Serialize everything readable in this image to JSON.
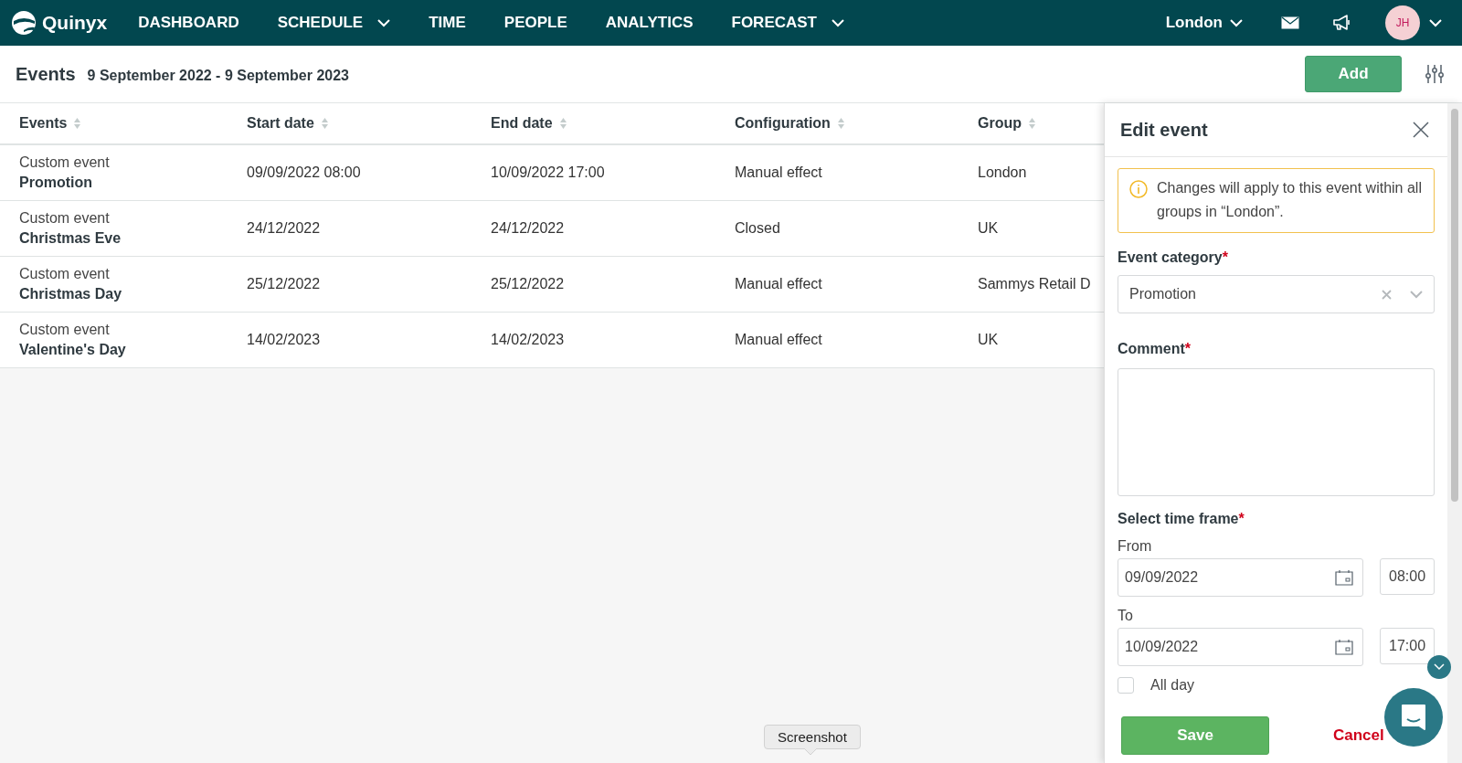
{
  "nav": {
    "brand": "Quinyx",
    "items": [
      {
        "label": "DASHBOARD",
        "dropdown": false
      },
      {
        "label": "SCHEDULE",
        "dropdown": true
      },
      {
        "label": "TIME",
        "dropdown": false
      },
      {
        "label": "PEOPLE",
        "dropdown": false
      },
      {
        "label": "ANALYTICS",
        "dropdown": false
      },
      {
        "label": "FORECAST",
        "dropdown": true
      }
    ],
    "location": "London",
    "avatar": "JH"
  },
  "page": {
    "title": "Events",
    "range": "9 September 2022 - 9 September 2023",
    "add_button": "Add"
  },
  "table": {
    "columns": [
      "Events",
      "Start date",
      "End date",
      "Configuration",
      "Group"
    ],
    "rows": [
      {
        "type": "Custom event",
        "name": "Promotion",
        "start": "09/09/2022 08:00",
        "end": "10/09/2022 17:00",
        "configuration": "Manual effect",
        "group": "London"
      },
      {
        "type": "Custom event",
        "name": "Christmas Eve",
        "start": "24/12/2022",
        "end": "24/12/2022",
        "configuration": "Closed",
        "group": "UK"
      },
      {
        "type": "Custom event",
        "name": "Christmas Day",
        "start": "25/12/2022",
        "end": "25/12/2022",
        "configuration": "Manual effect",
        "group": "Sammys Retail D"
      },
      {
        "type": "Custom event",
        "name": "Valentine's Day",
        "start": "14/02/2023",
        "end": "14/02/2023",
        "configuration": "Manual effect",
        "group": "UK"
      }
    ]
  },
  "edit_panel": {
    "title": "Edit event",
    "notice": "Changes will apply to this event within all groups in “London”.",
    "category": {
      "label": "Event category",
      "required_mark": "*",
      "value": "Promotion"
    },
    "comment": {
      "label": "Comment",
      "required_mark": "*"
    },
    "time_frame": {
      "label": "Select time frame",
      "required_mark": "*"
    },
    "from": {
      "label": "From",
      "date": "09/09/2022",
      "time": "08:00"
    },
    "to": {
      "label": "To",
      "date": "10/09/2022",
      "time": "17:00"
    },
    "all_day": {
      "label": "All day",
      "checked": false
    },
    "save": "Save",
    "cancel": "Cancel"
  },
  "tooltip": "Screenshot"
}
